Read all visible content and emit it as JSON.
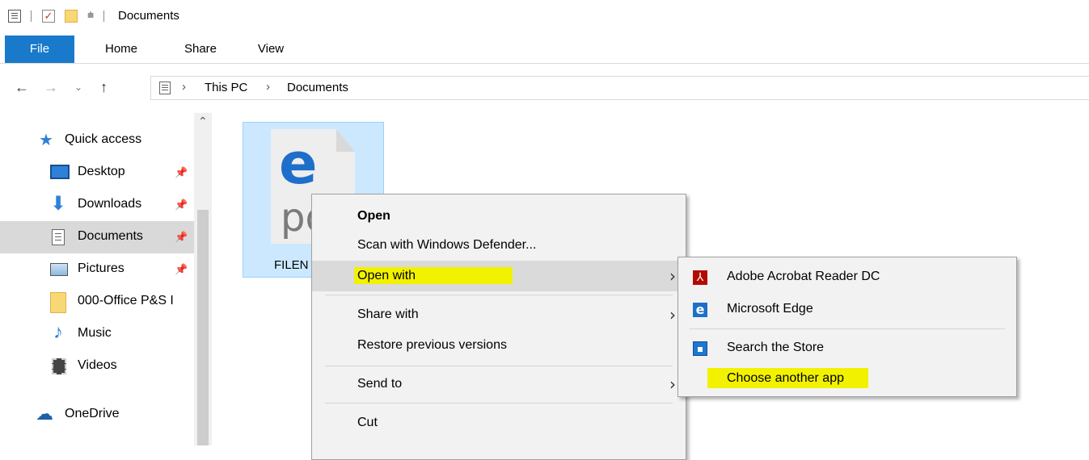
{
  "window": {
    "title": "Documents"
  },
  "ribbon": {
    "tabs": [
      "File",
      "Home",
      "Share",
      "View"
    ]
  },
  "address": {
    "crumbs": [
      "This PC",
      "Documents"
    ]
  },
  "navpane": {
    "items": [
      {
        "label": "Quick access",
        "icon": "star-icon"
      },
      {
        "label": "Desktop",
        "icon": "desktop-icon",
        "pinned": true
      },
      {
        "label": "Downloads",
        "icon": "download-arrow-icon",
        "pinned": true
      },
      {
        "label": "Documents",
        "icon": "documents-icon",
        "pinned": true,
        "selected": true
      },
      {
        "label": "Pictures",
        "icon": "pictures-icon",
        "pinned": true
      },
      {
        "label": "000-Office P&S I",
        "icon": "folder-icon"
      },
      {
        "label": "Music",
        "icon": "music-note-icon"
      },
      {
        "label": "Videos",
        "icon": "film-icon"
      },
      {
        "label": "OneDrive",
        "icon": "cloud-icon"
      }
    ]
  },
  "file": {
    "name": "FILEN",
    "icon_letter": "e",
    "icon_ext": "pd"
  },
  "context_menu": {
    "open": "Open",
    "scan": "Scan with Windows Defender...",
    "open_with": "Open with",
    "share_with": "Share with",
    "restore": "Restore previous versions",
    "send_to": "Send to",
    "cut": "Cut"
  },
  "open_with_menu": {
    "items": [
      {
        "label": "Adobe Acrobat Reader DC",
        "icon": "acrobat-icon"
      },
      {
        "label": "Microsoft Edge",
        "icon": "edge-icon"
      },
      {
        "label": "Search the Store",
        "icon": "store-icon"
      },
      {
        "label": "Choose another app",
        "icon": ""
      }
    ]
  },
  "colors": {
    "accent": "#1979ca",
    "selection": "#cce8ff",
    "highlight": "#f2f200"
  }
}
